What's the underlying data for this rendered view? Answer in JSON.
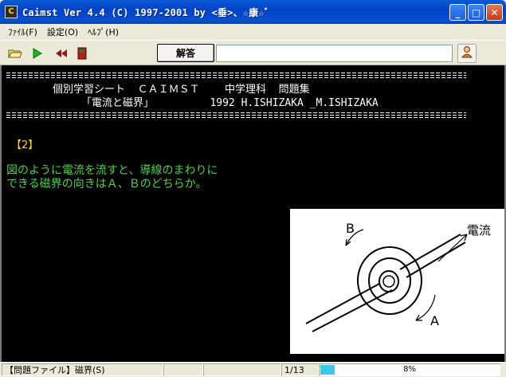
{
  "window": {
    "title": "Caimst Ver 4.4 (C) 1997-2001  by <垂>、☆康☆ﾞ",
    "app_icon": "caimst-app-icon"
  },
  "menu": {
    "file": "ﾌｧｲﾙ(F)",
    "settings": "設定(O)",
    "help": "ﾍﾙﾌﾟ(H)"
  },
  "toolbar": {
    "open_icon": "open-folder-icon",
    "play_icon": "play-icon",
    "rewind_icon": "rewind-icon",
    "stop_icon": "stop-icon",
    "answer_label": "解答",
    "answer_value": "",
    "user_icon": "user-icon"
  },
  "content": {
    "rule": "================================================================================",
    "header_line1": "個別学習シート  ＣＡＩＭＳＴ    中学理科  問題集",
    "header_line2": "「電流と磁界」         1992 H.ISHIZAKA _M.ISHIZAKA",
    "question_number": "【2】",
    "question_line1": "図のように電流を流すと、導線のまわりに",
    "question_line2": "できる磁界の向きはＡ、Ｂのどちらか。",
    "figure": {
      "label_b": "B",
      "label_a": "A",
      "label_current": "電流"
    }
  },
  "status": {
    "file": "【問題ファイル】磁界(S)",
    "cell2": "",
    "cell3": "",
    "page": "1/13",
    "progress_label": "8%",
    "progress_value": 0.08
  },
  "colors": {
    "question_number": "#ffd800",
    "question_text": "#4fd24f",
    "progress_fill": "#3ec7e8"
  }
}
